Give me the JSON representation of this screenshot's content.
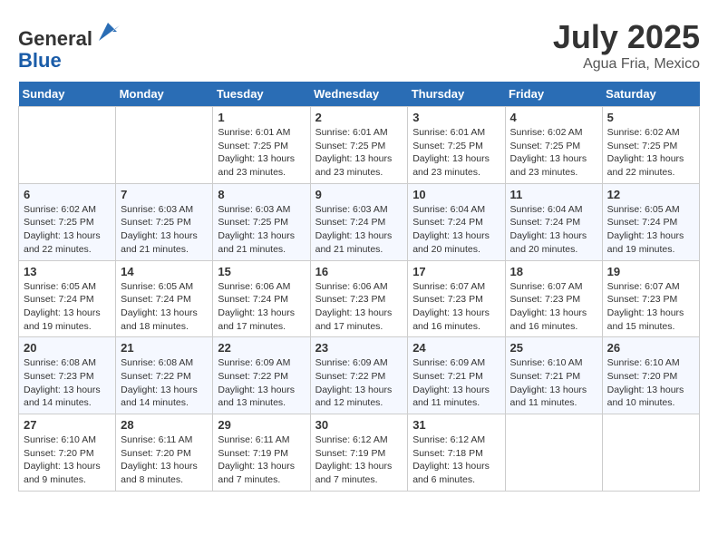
{
  "header": {
    "logo_line1": "General",
    "logo_line2": "Blue",
    "month": "July 2025",
    "location": "Agua Fria, Mexico"
  },
  "days_of_week": [
    "Sunday",
    "Monday",
    "Tuesday",
    "Wednesday",
    "Thursday",
    "Friday",
    "Saturday"
  ],
  "weeks": [
    [
      {
        "day": "",
        "info": ""
      },
      {
        "day": "",
        "info": ""
      },
      {
        "day": "1",
        "info": "Sunrise: 6:01 AM\nSunset: 7:25 PM\nDaylight: 13 hours and 23 minutes."
      },
      {
        "day": "2",
        "info": "Sunrise: 6:01 AM\nSunset: 7:25 PM\nDaylight: 13 hours and 23 minutes."
      },
      {
        "day": "3",
        "info": "Sunrise: 6:01 AM\nSunset: 7:25 PM\nDaylight: 13 hours and 23 minutes."
      },
      {
        "day": "4",
        "info": "Sunrise: 6:02 AM\nSunset: 7:25 PM\nDaylight: 13 hours and 23 minutes."
      },
      {
        "day": "5",
        "info": "Sunrise: 6:02 AM\nSunset: 7:25 PM\nDaylight: 13 hours and 22 minutes."
      }
    ],
    [
      {
        "day": "6",
        "info": "Sunrise: 6:02 AM\nSunset: 7:25 PM\nDaylight: 13 hours and 22 minutes."
      },
      {
        "day": "7",
        "info": "Sunrise: 6:03 AM\nSunset: 7:25 PM\nDaylight: 13 hours and 21 minutes."
      },
      {
        "day": "8",
        "info": "Sunrise: 6:03 AM\nSunset: 7:25 PM\nDaylight: 13 hours and 21 minutes."
      },
      {
        "day": "9",
        "info": "Sunrise: 6:03 AM\nSunset: 7:24 PM\nDaylight: 13 hours and 21 minutes."
      },
      {
        "day": "10",
        "info": "Sunrise: 6:04 AM\nSunset: 7:24 PM\nDaylight: 13 hours and 20 minutes."
      },
      {
        "day": "11",
        "info": "Sunrise: 6:04 AM\nSunset: 7:24 PM\nDaylight: 13 hours and 20 minutes."
      },
      {
        "day": "12",
        "info": "Sunrise: 6:05 AM\nSunset: 7:24 PM\nDaylight: 13 hours and 19 minutes."
      }
    ],
    [
      {
        "day": "13",
        "info": "Sunrise: 6:05 AM\nSunset: 7:24 PM\nDaylight: 13 hours and 19 minutes."
      },
      {
        "day": "14",
        "info": "Sunrise: 6:05 AM\nSunset: 7:24 PM\nDaylight: 13 hours and 18 minutes."
      },
      {
        "day": "15",
        "info": "Sunrise: 6:06 AM\nSunset: 7:24 PM\nDaylight: 13 hours and 17 minutes."
      },
      {
        "day": "16",
        "info": "Sunrise: 6:06 AM\nSunset: 7:23 PM\nDaylight: 13 hours and 17 minutes."
      },
      {
        "day": "17",
        "info": "Sunrise: 6:07 AM\nSunset: 7:23 PM\nDaylight: 13 hours and 16 minutes."
      },
      {
        "day": "18",
        "info": "Sunrise: 6:07 AM\nSunset: 7:23 PM\nDaylight: 13 hours and 16 minutes."
      },
      {
        "day": "19",
        "info": "Sunrise: 6:07 AM\nSunset: 7:23 PM\nDaylight: 13 hours and 15 minutes."
      }
    ],
    [
      {
        "day": "20",
        "info": "Sunrise: 6:08 AM\nSunset: 7:23 PM\nDaylight: 13 hours and 14 minutes."
      },
      {
        "day": "21",
        "info": "Sunrise: 6:08 AM\nSunset: 7:22 PM\nDaylight: 13 hours and 14 minutes."
      },
      {
        "day": "22",
        "info": "Sunrise: 6:09 AM\nSunset: 7:22 PM\nDaylight: 13 hours and 13 minutes."
      },
      {
        "day": "23",
        "info": "Sunrise: 6:09 AM\nSunset: 7:22 PM\nDaylight: 13 hours and 12 minutes."
      },
      {
        "day": "24",
        "info": "Sunrise: 6:09 AM\nSunset: 7:21 PM\nDaylight: 13 hours and 11 minutes."
      },
      {
        "day": "25",
        "info": "Sunrise: 6:10 AM\nSunset: 7:21 PM\nDaylight: 13 hours and 11 minutes."
      },
      {
        "day": "26",
        "info": "Sunrise: 6:10 AM\nSunset: 7:20 PM\nDaylight: 13 hours and 10 minutes."
      }
    ],
    [
      {
        "day": "27",
        "info": "Sunrise: 6:10 AM\nSunset: 7:20 PM\nDaylight: 13 hours and 9 minutes."
      },
      {
        "day": "28",
        "info": "Sunrise: 6:11 AM\nSunset: 7:20 PM\nDaylight: 13 hours and 8 minutes."
      },
      {
        "day": "29",
        "info": "Sunrise: 6:11 AM\nSunset: 7:19 PM\nDaylight: 13 hours and 7 minutes."
      },
      {
        "day": "30",
        "info": "Sunrise: 6:12 AM\nSunset: 7:19 PM\nDaylight: 13 hours and 7 minutes."
      },
      {
        "day": "31",
        "info": "Sunrise: 6:12 AM\nSunset: 7:18 PM\nDaylight: 13 hours and 6 minutes."
      },
      {
        "day": "",
        "info": ""
      },
      {
        "day": "",
        "info": ""
      }
    ]
  ]
}
